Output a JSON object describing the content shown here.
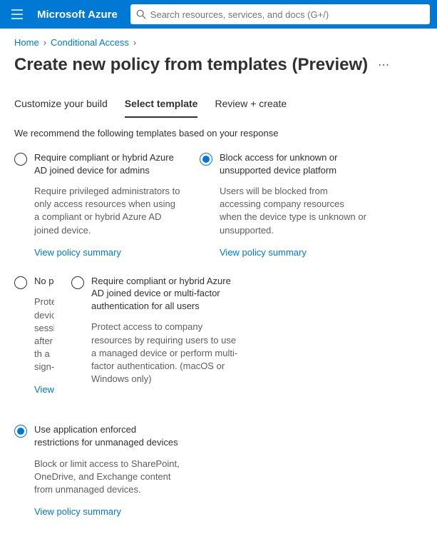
{
  "topbar": {
    "brand": "Microsoft Azure",
    "search_placeholder": "Search resources, services, and docs (G+/)"
  },
  "breadcrumbs": {
    "home": "Home",
    "conditional_access": "Conditional Access"
  },
  "page_title": "Create new policy from templates (Preview)",
  "tabs": {
    "customize": "Customize your build",
    "select": "Select template",
    "review": "Review + create"
  },
  "recommend_text": "We recommend the following templates based on your response",
  "templates": [
    {
      "title": "Require compliant or hybrid Azure AD joined device for admins",
      "desc": "Require privileged administrators to only access resources when using a compliant or hybrid Azure AD joined device.",
      "link": "View policy summary",
      "selected": false
    },
    {
      "title": "Block access for unknown or unsupported device platform",
      "desc": "Users will be blocked from accessing company resources when the device type is unknown or unsupported.",
      "link": "View policy summary",
      "selected": true
    },
    {
      "title": "No per",
      "desc": "Protect devices session after th a sign-",
      "link": "View p",
      "selected": false
    },
    {
      "title": "Require compliant or hybrid Azure AD joined device or multi-factor authentication for all users",
      "desc": "Protect access to company resources by requiring users to use a managed device or perform multi-factor authentication. (macOS or Windows only)",
      "link": "",
      "selected": false
    },
    {
      "title": "Use application enforced restrictions for unmanaged devices",
      "desc": "Block or limit access to SharePoint, OneDrive, and Exchange content from unmanaged devices.",
      "link": "View policy summary",
      "selected": true
    }
  ]
}
